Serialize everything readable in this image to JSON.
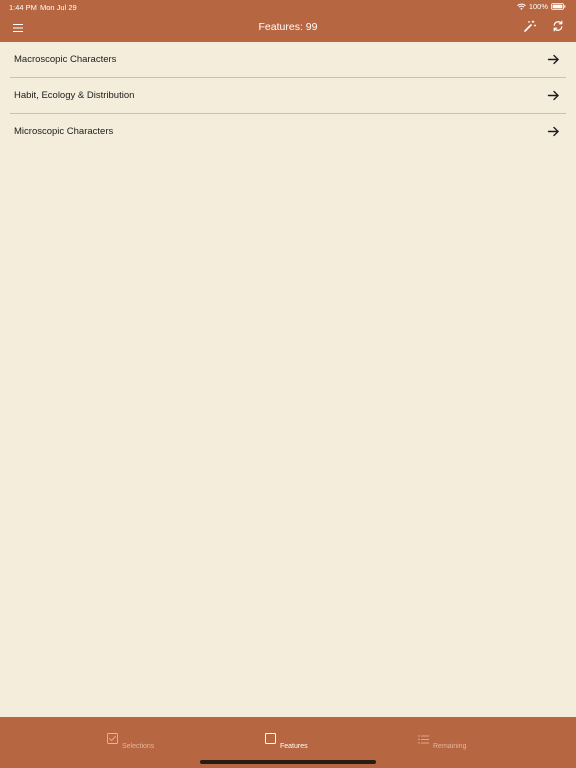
{
  "status_bar": {
    "time": "1:44 PM",
    "date": "Mon Jul 29",
    "battery": "100%"
  },
  "nav": {
    "title": "Features: 99",
    "menu_icon": "hamburger-icon",
    "wand_icon": "magic-wand-icon",
    "refresh_icon": "refresh-icon"
  },
  "list": {
    "items": [
      {
        "label": "Macroscopic Characters",
        "icon": "arrow-right-icon"
      },
      {
        "label": "Habit, Ecology & Distribution",
        "icon": "arrow-right-icon"
      },
      {
        "label": "Microscopic Characters",
        "icon": "arrow-right-icon"
      }
    ]
  },
  "tabbar": {
    "tabs": [
      {
        "label": "Selections",
        "icon": "checkbox-checked-icon",
        "active": false
      },
      {
        "label": "Features",
        "icon": "checkbox-empty-icon",
        "active": true
      },
      {
        "label": "Remaining",
        "icon": "list-icon",
        "active": false
      }
    ]
  },
  "colors": {
    "accent": "#b66641",
    "background": "#f4eddc",
    "inactive_tab": "#e7b59c",
    "text": "#1c1c1c"
  }
}
